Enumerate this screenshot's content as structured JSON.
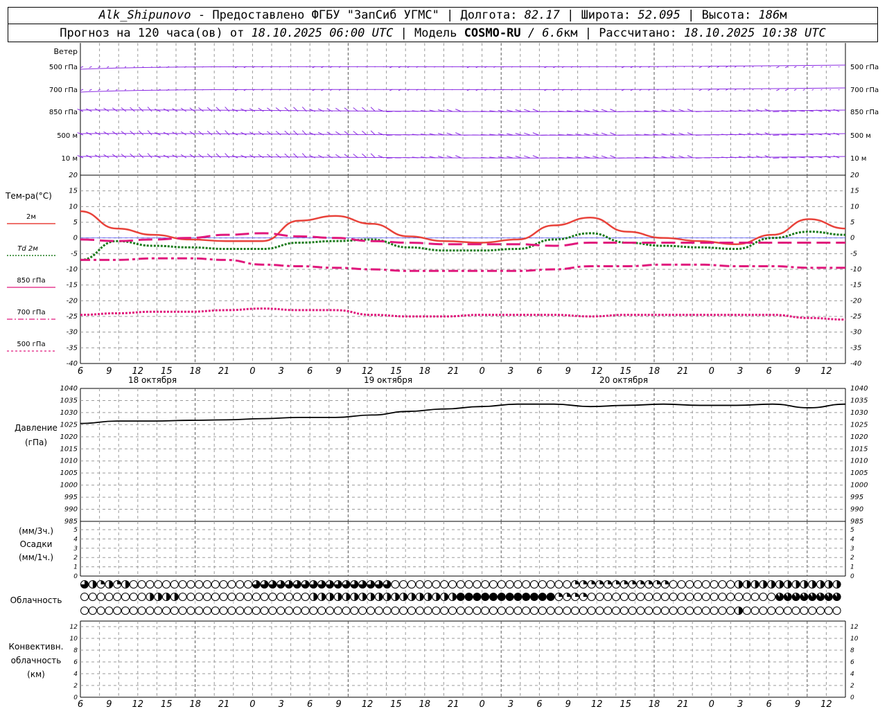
{
  "header": {
    "station": "Alk_Shipunovo",
    "provider": " - Предоставлено ФГБУ \"ЗапСиб УГМС\" | Долгота: ",
    "lon": "82.17",
    "lat_label": " | Широта: ",
    "lat": "52.095",
    "alt_label": " | Высота: ",
    "alt": "186",
    "alt_unit": "м",
    "forecast_prefix": "Прогноз на 120 часа(ов) от ",
    "forecast_time": "18.10.2025 06:00 UTC",
    "model_label": " | Модель ",
    "model": "COSMO-RU",
    "model_res": " / 6.6",
    "model_res_unit": "км",
    "calc_label": " | Рассчитано: ",
    "calc_time": "18.10.2025 10:38 UTC"
  },
  "colors": {
    "wind": "#8a2be2",
    "t2m": "#e8423a",
    "td2m": "#1a7a1a",
    "t850": "#e0187c",
    "t700": "#e0187c",
    "t500": "#e0187c",
    "pressure": "#000000",
    "grid": "#9a9a9a",
    "zero_line": "#3a3aff"
  },
  "panels": {
    "wind": {
      "title": "Ветер",
      "levels": [
        "500 гПа",
        "700 гПа",
        "850 гПа",
        "500 м",
        "10 м"
      ]
    },
    "temp": {
      "title": "Тем-ра(°C)",
      "legend": [
        "2м",
        "Td 2м",
        "850 гПа",
        "700 гПа",
        "500 гПа"
      ]
    },
    "pressure": {
      "title1": "Давление",
      "title2": "(гПа)"
    },
    "precip": {
      "title1": "(мм/3ч.)",
      "title2": "Осадки",
      "title3": "(мм/1ч.)"
    },
    "cloud": {
      "title": "Облачность"
    },
    "conv": {
      "title1": "Конвективн.",
      "title2": "облачность",
      "title3": "(км)"
    }
  },
  "time_axis": {
    "hour_labels": [
      "6",
      "9",
      "12",
      "15",
      "18",
      "21",
      "0",
      "3",
      "6",
      "9",
      "12",
      "15",
      "18",
      "21",
      "0",
      "3",
      "6",
      "9",
      "12",
      "15",
      "18",
      "21",
      "0",
      "3",
      "6",
      "9",
      "12"
    ],
    "days": [
      "18 октября",
      "19 октября",
      "20 октября"
    ]
  },
  "chart_data": [
    {
      "type": "line",
      "title": "Тем-ра(°C)",
      "x_hours": [
        0,
        6,
        12,
        18,
        24,
        30,
        36,
        42,
        48,
        54,
        60,
        66,
        72,
        78,
        84,
        90,
        96,
        102,
        108,
        114,
        120
      ],
      "ylim": [
        -40,
        20
      ],
      "series": [
        {
          "name": "2м",
          "values": [
            8.5,
            3,
            1,
            -0.5,
            -1,
            -1,
            5.5,
            7,
            4.5,
            0.5,
            -1,
            -1.5,
            -0.5,
            4,
            6.5,
            2,
            0,
            -1,
            -2,
            1,
            6,
            3
          ]
        },
        {
          "name": "Td 2м",
          "values": [
            -7,
            -1,
            -2.5,
            -3,
            -3.5,
            -3.5,
            -1.5,
            -1,
            -0.5,
            -3,
            -4,
            -4,
            -3.5,
            -0.5,
            1.5,
            -1.5,
            -2.5,
            -3,
            -3.5,
            0,
            2,
            1
          ]
        },
        {
          "name": "850 гПа",
          "values": [
            -0.5,
            -1,
            -0.5,
            0,
            1,
            1.5,
            0.5,
            0,
            -1,
            -1.5,
            -2,
            -2,
            -2,
            -2.5,
            -1.5,
            -1.5,
            -1.5,
            -1.5,
            -1.5,
            -1.5,
            -1.5,
            -1.5
          ]
        },
        {
          "name": "700 гПа",
          "values": [
            -7,
            -7,
            -6.5,
            -6.5,
            -7,
            -8.5,
            -9,
            -9.5,
            -10,
            -10.5,
            -10.5,
            -10.5,
            -10.5,
            -10,
            -9,
            -9,
            -8.5,
            -8.5,
            -9,
            -9,
            -9.5,
            -9.5
          ]
        },
        {
          "name": "500 гПа",
          "values": [
            -24.5,
            -24,
            -23.5,
            -23.5,
            -23,
            -22.5,
            -23,
            -23,
            -24.5,
            -25,
            -25,
            -24.5,
            -24.5,
            -24.5,
            -25,
            -24.5,
            -24.5,
            -24.5,
            -24.5,
            -24.5,
            -25.5,
            -26
          ]
        }
      ]
    },
    {
      "type": "line",
      "title": "Давление",
      "ylim": [
        985,
        1040
      ],
      "series": [
        {
          "name": "Давление",
          "values": [
            1025.5,
            1026.5,
            1026.5,
            1026.8,
            1027,
            1027.5,
            1028,
            1028,
            1029,
            1030.5,
            1031.5,
            1032.5,
            1033.5,
            1033.5,
            1032.5,
            1033,
            1033.5,
            1033,
            1033,
            1033.5,
            1032,
            1033.5
          ]
        }
      ]
    },
    {
      "type": "bar",
      "title": "Осадки",
      "ylim": [
        0,
        5
      ],
      "values": []
    }
  ]
}
